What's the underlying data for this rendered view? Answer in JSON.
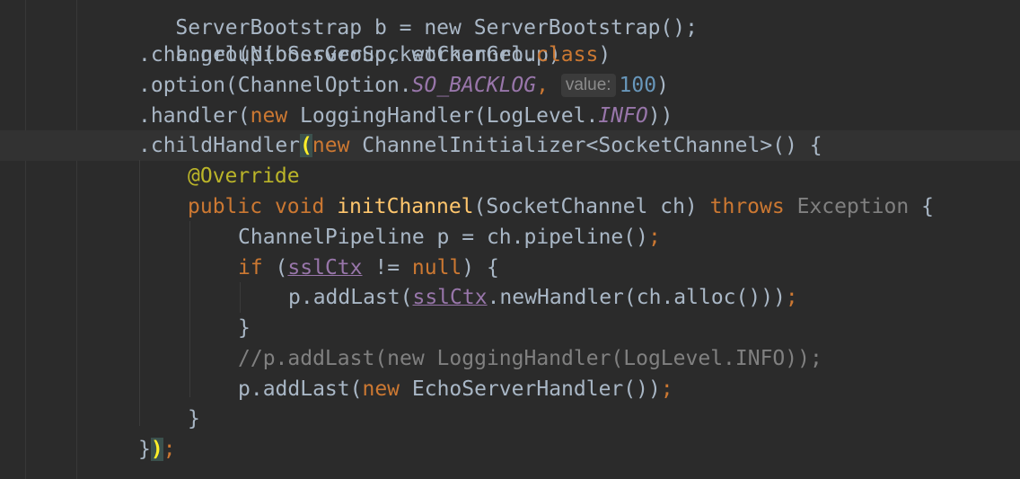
{
  "editor": {
    "lines": {
      "l0": {
        "text": "ServerBootstrap b = new ServerBootstrap();"
      },
      "l1": {
        "text": "b.group(bossGroup, workerGroup)"
      },
      "l2": {
        "p1": ".channel(NioServerSocketChannel.",
        "kw": "class",
        "p2": ")"
      },
      "l3": {
        "p1": ".option(ChannelOption.",
        "const": "SO_BACKLOG",
        "comma": ",",
        "hint": "value:",
        "num": "100",
        "p2": ")"
      },
      "l4": {
        "p1": ".handler(",
        "kw": "new",
        "p2": " LoggingHandler(LogLevel.",
        "const": "INFO",
        "p3": "))"
      },
      "l5": {
        "p1": ".childHandler",
        "brace": "(",
        "kw": "new",
        "p2": " ChannelInitializer<SocketChannel>() {"
      },
      "l6": {
        "anno": "@Override"
      },
      "l7": {
        "kw1": "public",
        "kw2": "void",
        "fn": "initChannel",
        "p1": "(SocketChannel ch) ",
        "kw3": "throws",
        "ex": "Exception",
        "p2": " {"
      },
      "l8": {
        "p1": "ChannelPipeline p = ch.pipeline()",
        "semi": ";"
      },
      "l9": {
        "kw": "if",
        "p1": " (",
        "field": "sslCtx",
        "p2": " != ",
        "kw2": "null",
        "p3": ") {"
      },
      "l10": {
        "p1": "p.addLast(",
        "field": "sslCtx",
        "p2": ".newHandler(ch.alloc()))",
        "semi": ";"
      },
      "l11": {
        "text": "}"
      },
      "l12": {
        "text": "//p.addLast(new LoggingHandler(LogLevel.INFO));"
      },
      "l13": {
        "p1": "p.addLast(",
        "kw": "new",
        "p2": " EchoServerHandler())",
        "semi": ";"
      },
      "l14": {
        "text": "}"
      },
      "l15": {
        "p1": "}",
        "brace": ")",
        "semi": ";"
      }
    }
  },
  "colors": {
    "background": "#2b2b2b",
    "text": "#a9b7c6",
    "keyword": "#cc7832",
    "method": "#ffc66d",
    "number": "#6897bb",
    "constant": "#9876aa",
    "annotation": "#bbb529",
    "comment": "#808080"
  }
}
